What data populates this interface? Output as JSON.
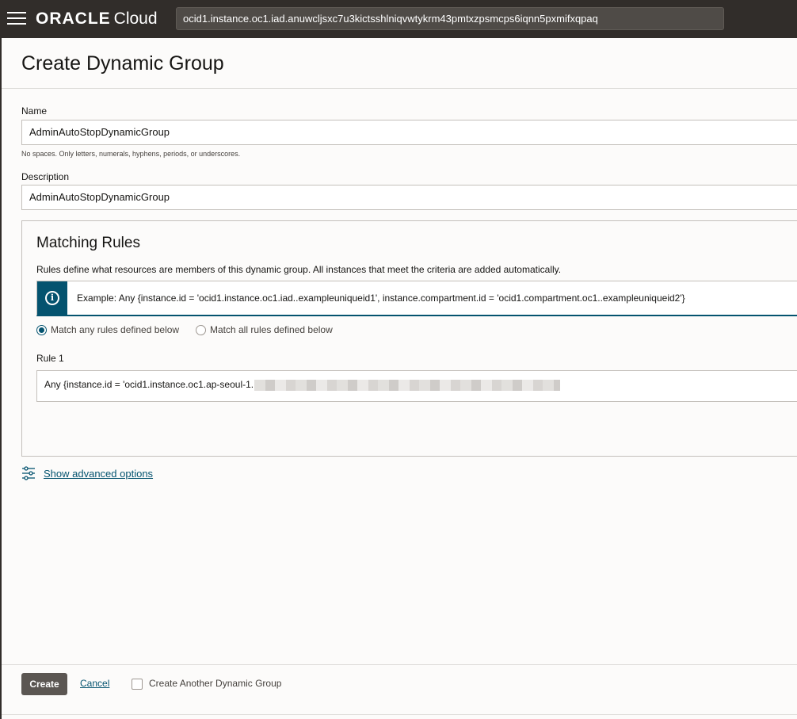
{
  "topbar": {
    "brand": "ORACLE",
    "brand_suffix": "Cloud",
    "search_value": "ocid1.instance.oc1.iad.anuwcljsxc7u3kictsshlniqvwtykrm43pmtxzpsmcps6iqnn5pxmifxqpaq"
  },
  "panel": {
    "title": "Create Dynamic Group"
  },
  "form": {
    "name_label": "Name",
    "name_value": "AdminAutoStopDynamicGroup",
    "name_help": "No spaces. Only letters, numerals, hyphens, periods, or underscores.",
    "description_label": "Description",
    "description_value": "AdminAutoStopDynamicGroup"
  },
  "matching_rules": {
    "title": "Matching Rules",
    "description": "Rules define what resources are members of this dynamic group. All instances that meet the criteria are added automatically.",
    "example": "Example: Any {instance.id = 'ocid1.instance.oc1.iad..exampleuniqueid1', instance.compartment.id = 'ocid1.compartment.oc1..exampleuniqueid2'}",
    "match_any_label": "Match any rules defined below",
    "match_all_label": "Match all rules defined below",
    "selected": "match_any",
    "rule1_label": "Rule 1",
    "rule1_value": "Any {instance.id = 'ocid1.instance.oc1.ap-seoul-1."
  },
  "advanced": {
    "link": "Show advanced options"
  },
  "footer": {
    "create_label": "Create",
    "cancel_label": "Cancel",
    "another_label": "Create Another Dynamic Group"
  },
  "colors": {
    "accent": "#04536f",
    "topbar": "#312d2a",
    "button": "#5b5652"
  }
}
